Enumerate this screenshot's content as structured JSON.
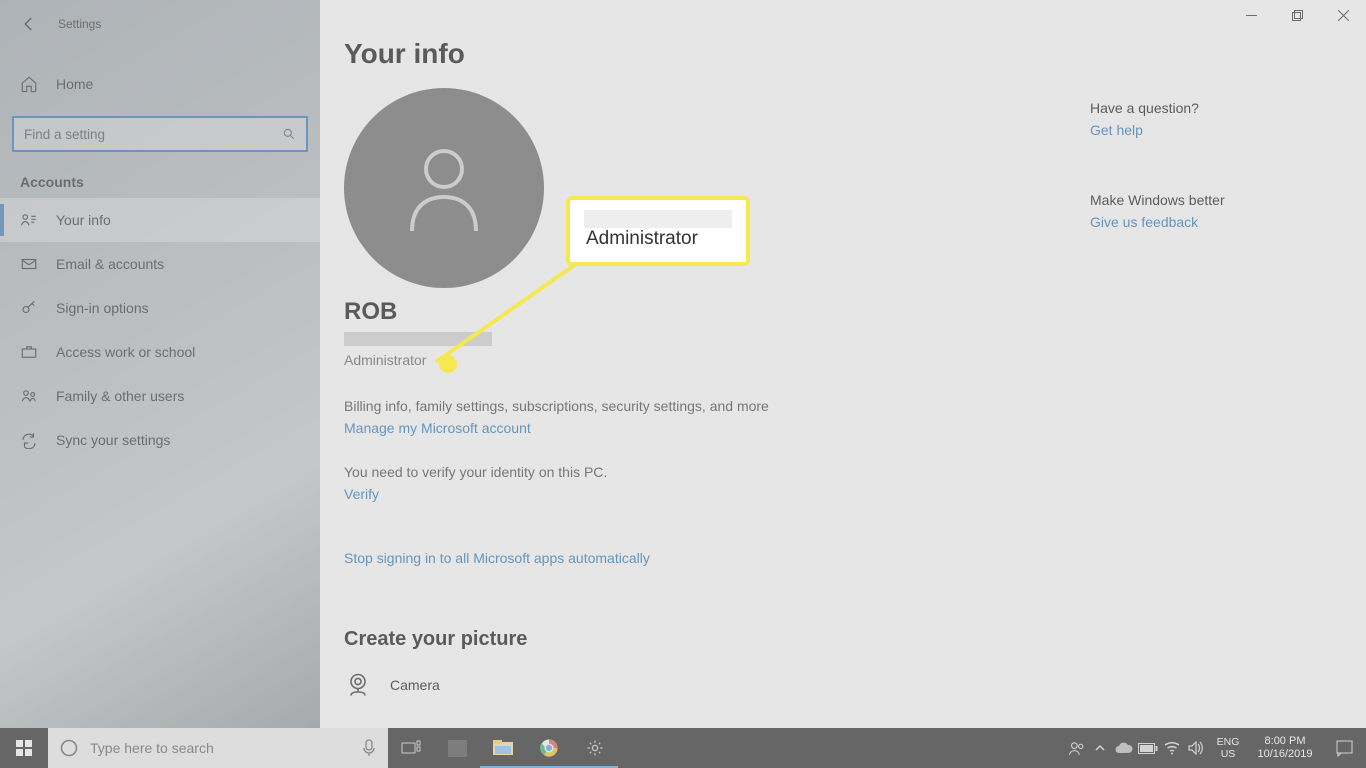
{
  "header": {
    "app_title": "Settings"
  },
  "search": {
    "placeholder": "Find a setting"
  },
  "home": {
    "label": "Home"
  },
  "category": "Accounts",
  "nav": {
    "items": [
      {
        "label": "Your info"
      },
      {
        "label": "Email & accounts"
      },
      {
        "label": "Sign-in options"
      },
      {
        "label": "Access work or school"
      },
      {
        "label": "Family & other users"
      },
      {
        "label": "Sync your settings"
      }
    ]
  },
  "page": {
    "title": "Your info",
    "user_name": "ROB",
    "role": "Administrator",
    "billing": "Billing info, family settings, subscriptions, security settings, and more",
    "manage": "Manage my Microsoft account",
    "verify_text": "You need to verify your identity on this PC.",
    "verify_link": "Verify",
    "stop": "Stop signing in to all Microsoft apps automatically",
    "create": "Create your picture",
    "camera": "Camera"
  },
  "callout": {
    "text": "Administrator"
  },
  "right": {
    "question": "Have a question?",
    "get_help": "Get help",
    "mwb": "Make Windows better",
    "feedback": "Give us feedback"
  },
  "taskbar": {
    "search_placeholder": "Type here to search",
    "lang1": "ENG",
    "lang2": "US",
    "time": "8:00 PM",
    "date": "10/16/2019"
  }
}
